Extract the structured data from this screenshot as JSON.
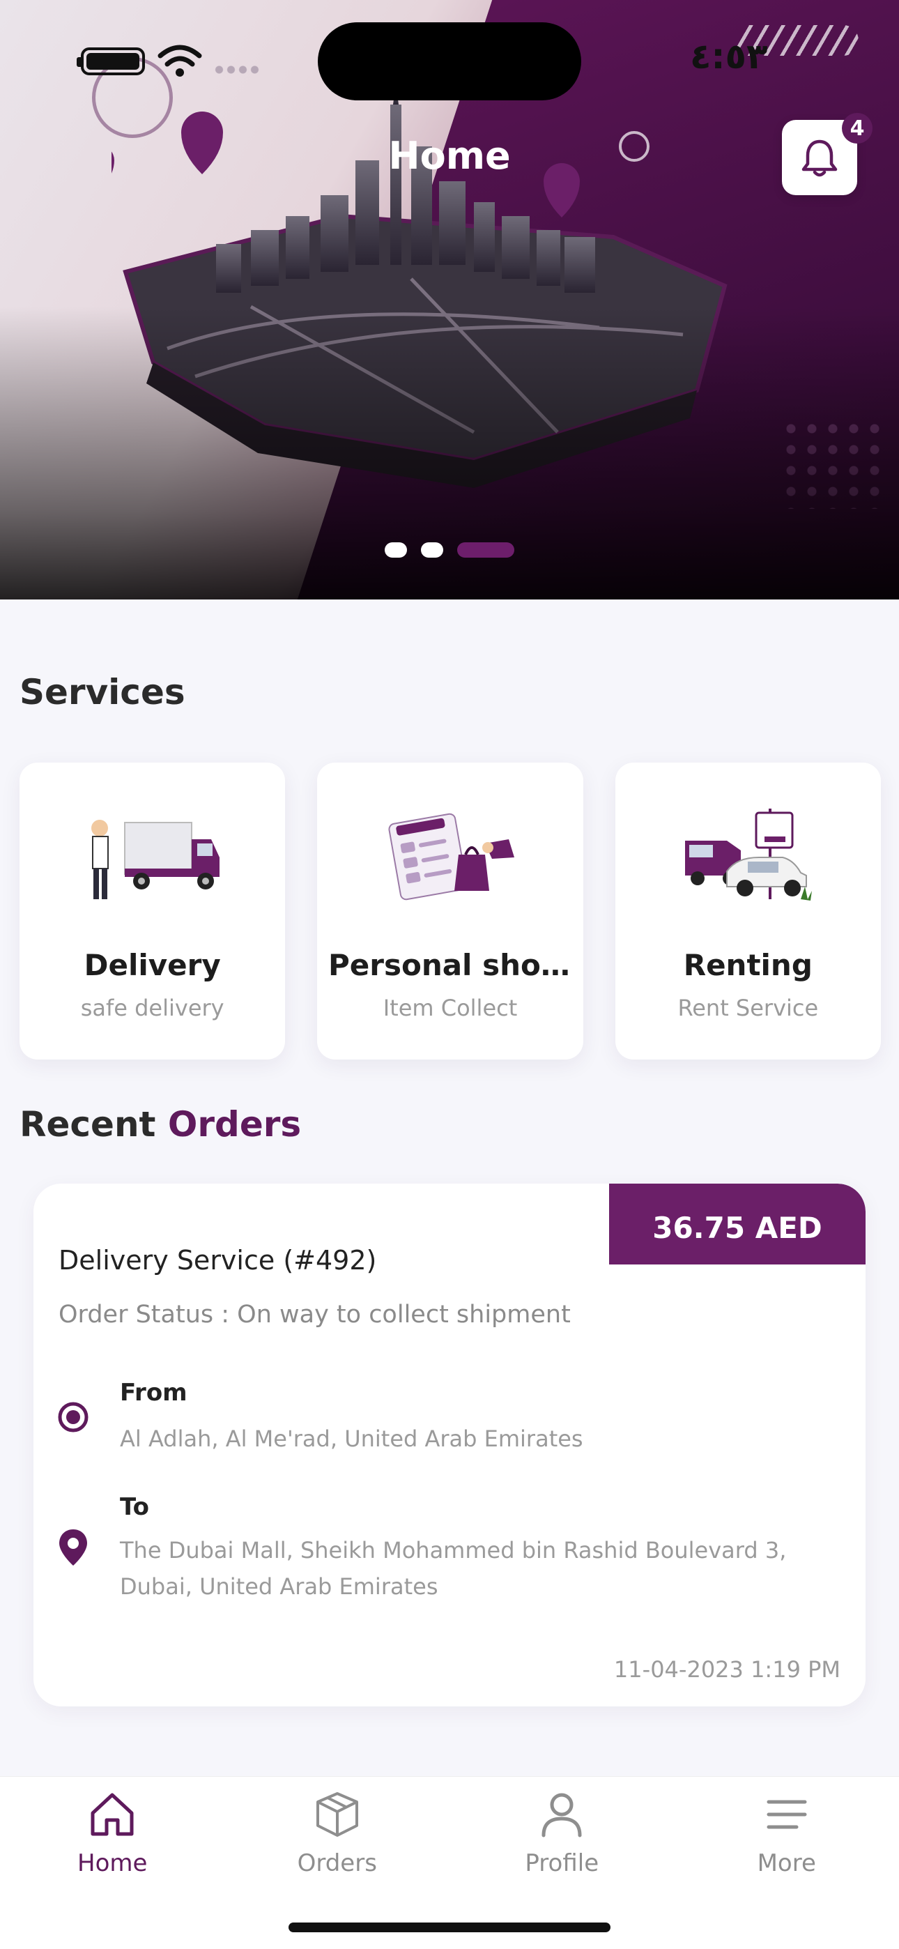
{
  "status_bar": {
    "time": "٤:٥٣"
  },
  "header": {
    "title": "Home",
    "notification_count": "4"
  },
  "carousel": {
    "slides": 3,
    "active_index": 2
  },
  "services": {
    "title": "Services",
    "items": [
      {
        "title": "Delivery",
        "subtitle": "safe delivery",
        "icon": "delivery-truck-icon"
      },
      {
        "title": "Personal shopping",
        "subtitle": "Item Collect",
        "icon": "shopping-bags-icon"
      },
      {
        "title": "Renting",
        "subtitle": "Rent Service",
        "icon": "rent-vehicles-icon"
      }
    ]
  },
  "recent_orders": {
    "title_part1": "Recent ",
    "title_part2": "Orders",
    "order": {
      "price": "36.75 AED",
      "title": "Delivery Service (#492)",
      "status": "Order Status : On way to collect shipment",
      "from_label": "From",
      "from_address": "Al Adlah, Al Me'rad, United Arab Emirates",
      "to_label": "To",
      "to_address": "The Dubai Mall, Sheikh Mohammed bin Rashid Boulevard 3, Dubai, United Arab Emirates",
      "date": "11-04-2023 1:19 PM"
    }
  },
  "bottom_nav": {
    "items": [
      {
        "label": "Home",
        "icon": "home-icon",
        "active": true
      },
      {
        "label": "Orders",
        "icon": "box-icon",
        "active": false
      },
      {
        "label": "Profile",
        "icon": "user-icon",
        "active": false
      },
      {
        "label": "More",
        "icon": "menu-icon",
        "active": false
      }
    ]
  },
  "colors": {
    "brand": "#5e1a5c",
    "brand_tag": "#6b1f68",
    "muted": "#9a9a9a"
  }
}
